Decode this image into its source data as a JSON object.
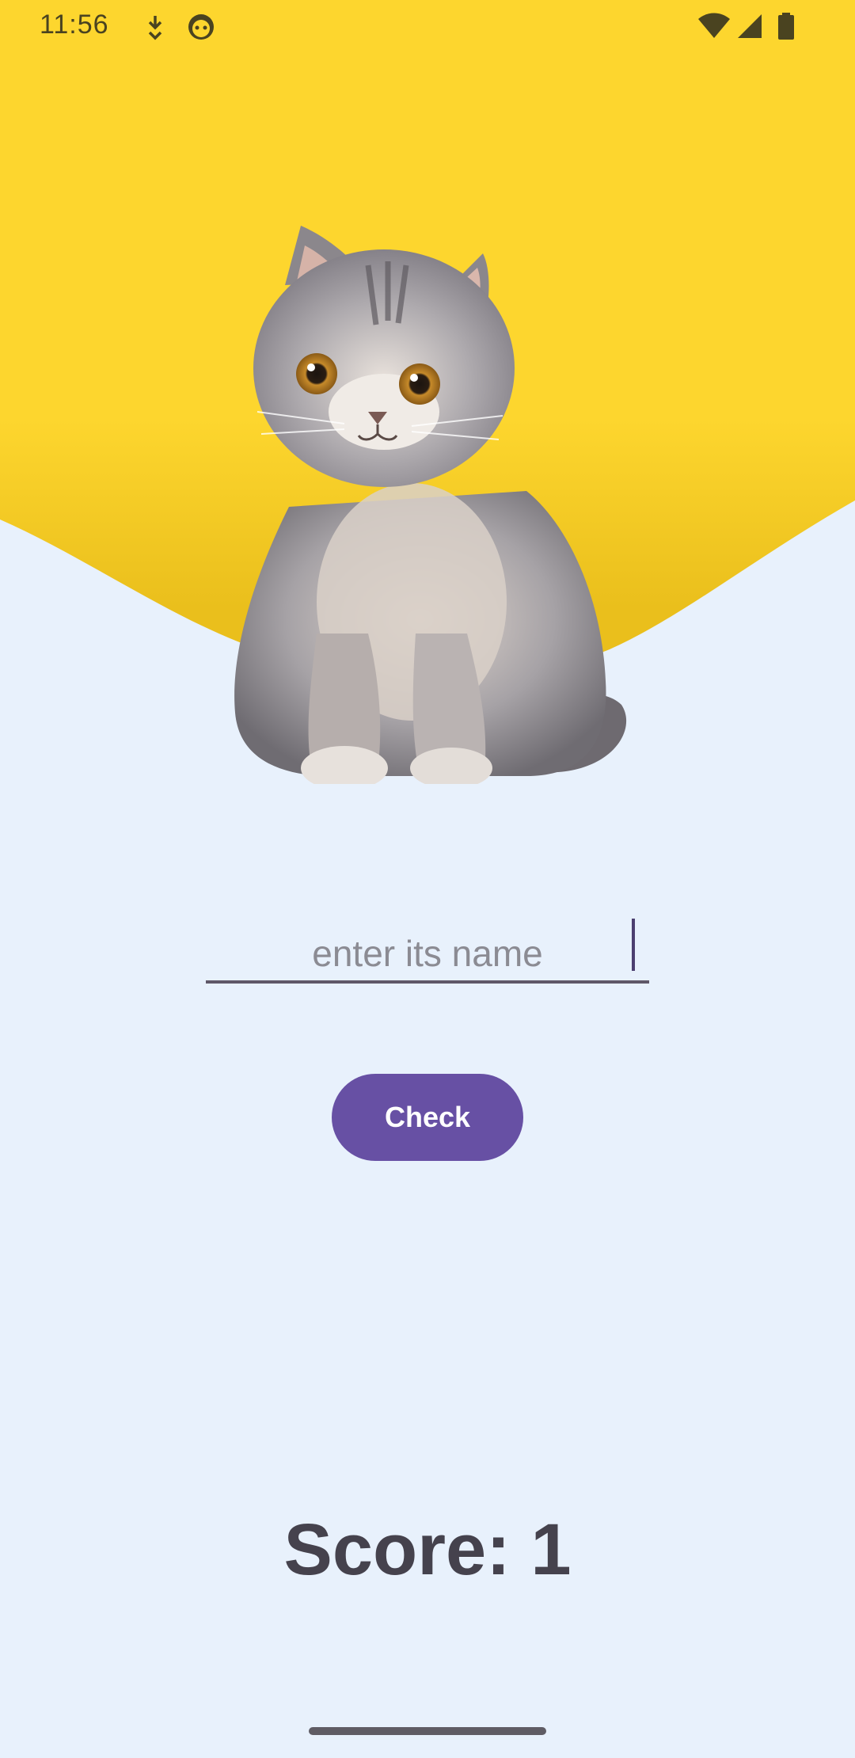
{
  "status_bar": {
    "time": "11:56",
    "icons": [
      "download-icon",
      "face-icon",
      "wifi-icon",
      "cellular-signal-icon",
      "battery-icon"
    ]
  },
  "colors": {
    "background": "#e8f1fc",
    "header_yellow": "#fdd62e",
    "button": "#6750a4",
    "text": "#45424d"
  },
  "main": {
    "image": "cat-photo",
    "name_input": {
      "placeholder": "enter its name",
      "value": ""
    },
    "check_button_label": "Check",
    "score_text": "Score: 1"
  }
}
